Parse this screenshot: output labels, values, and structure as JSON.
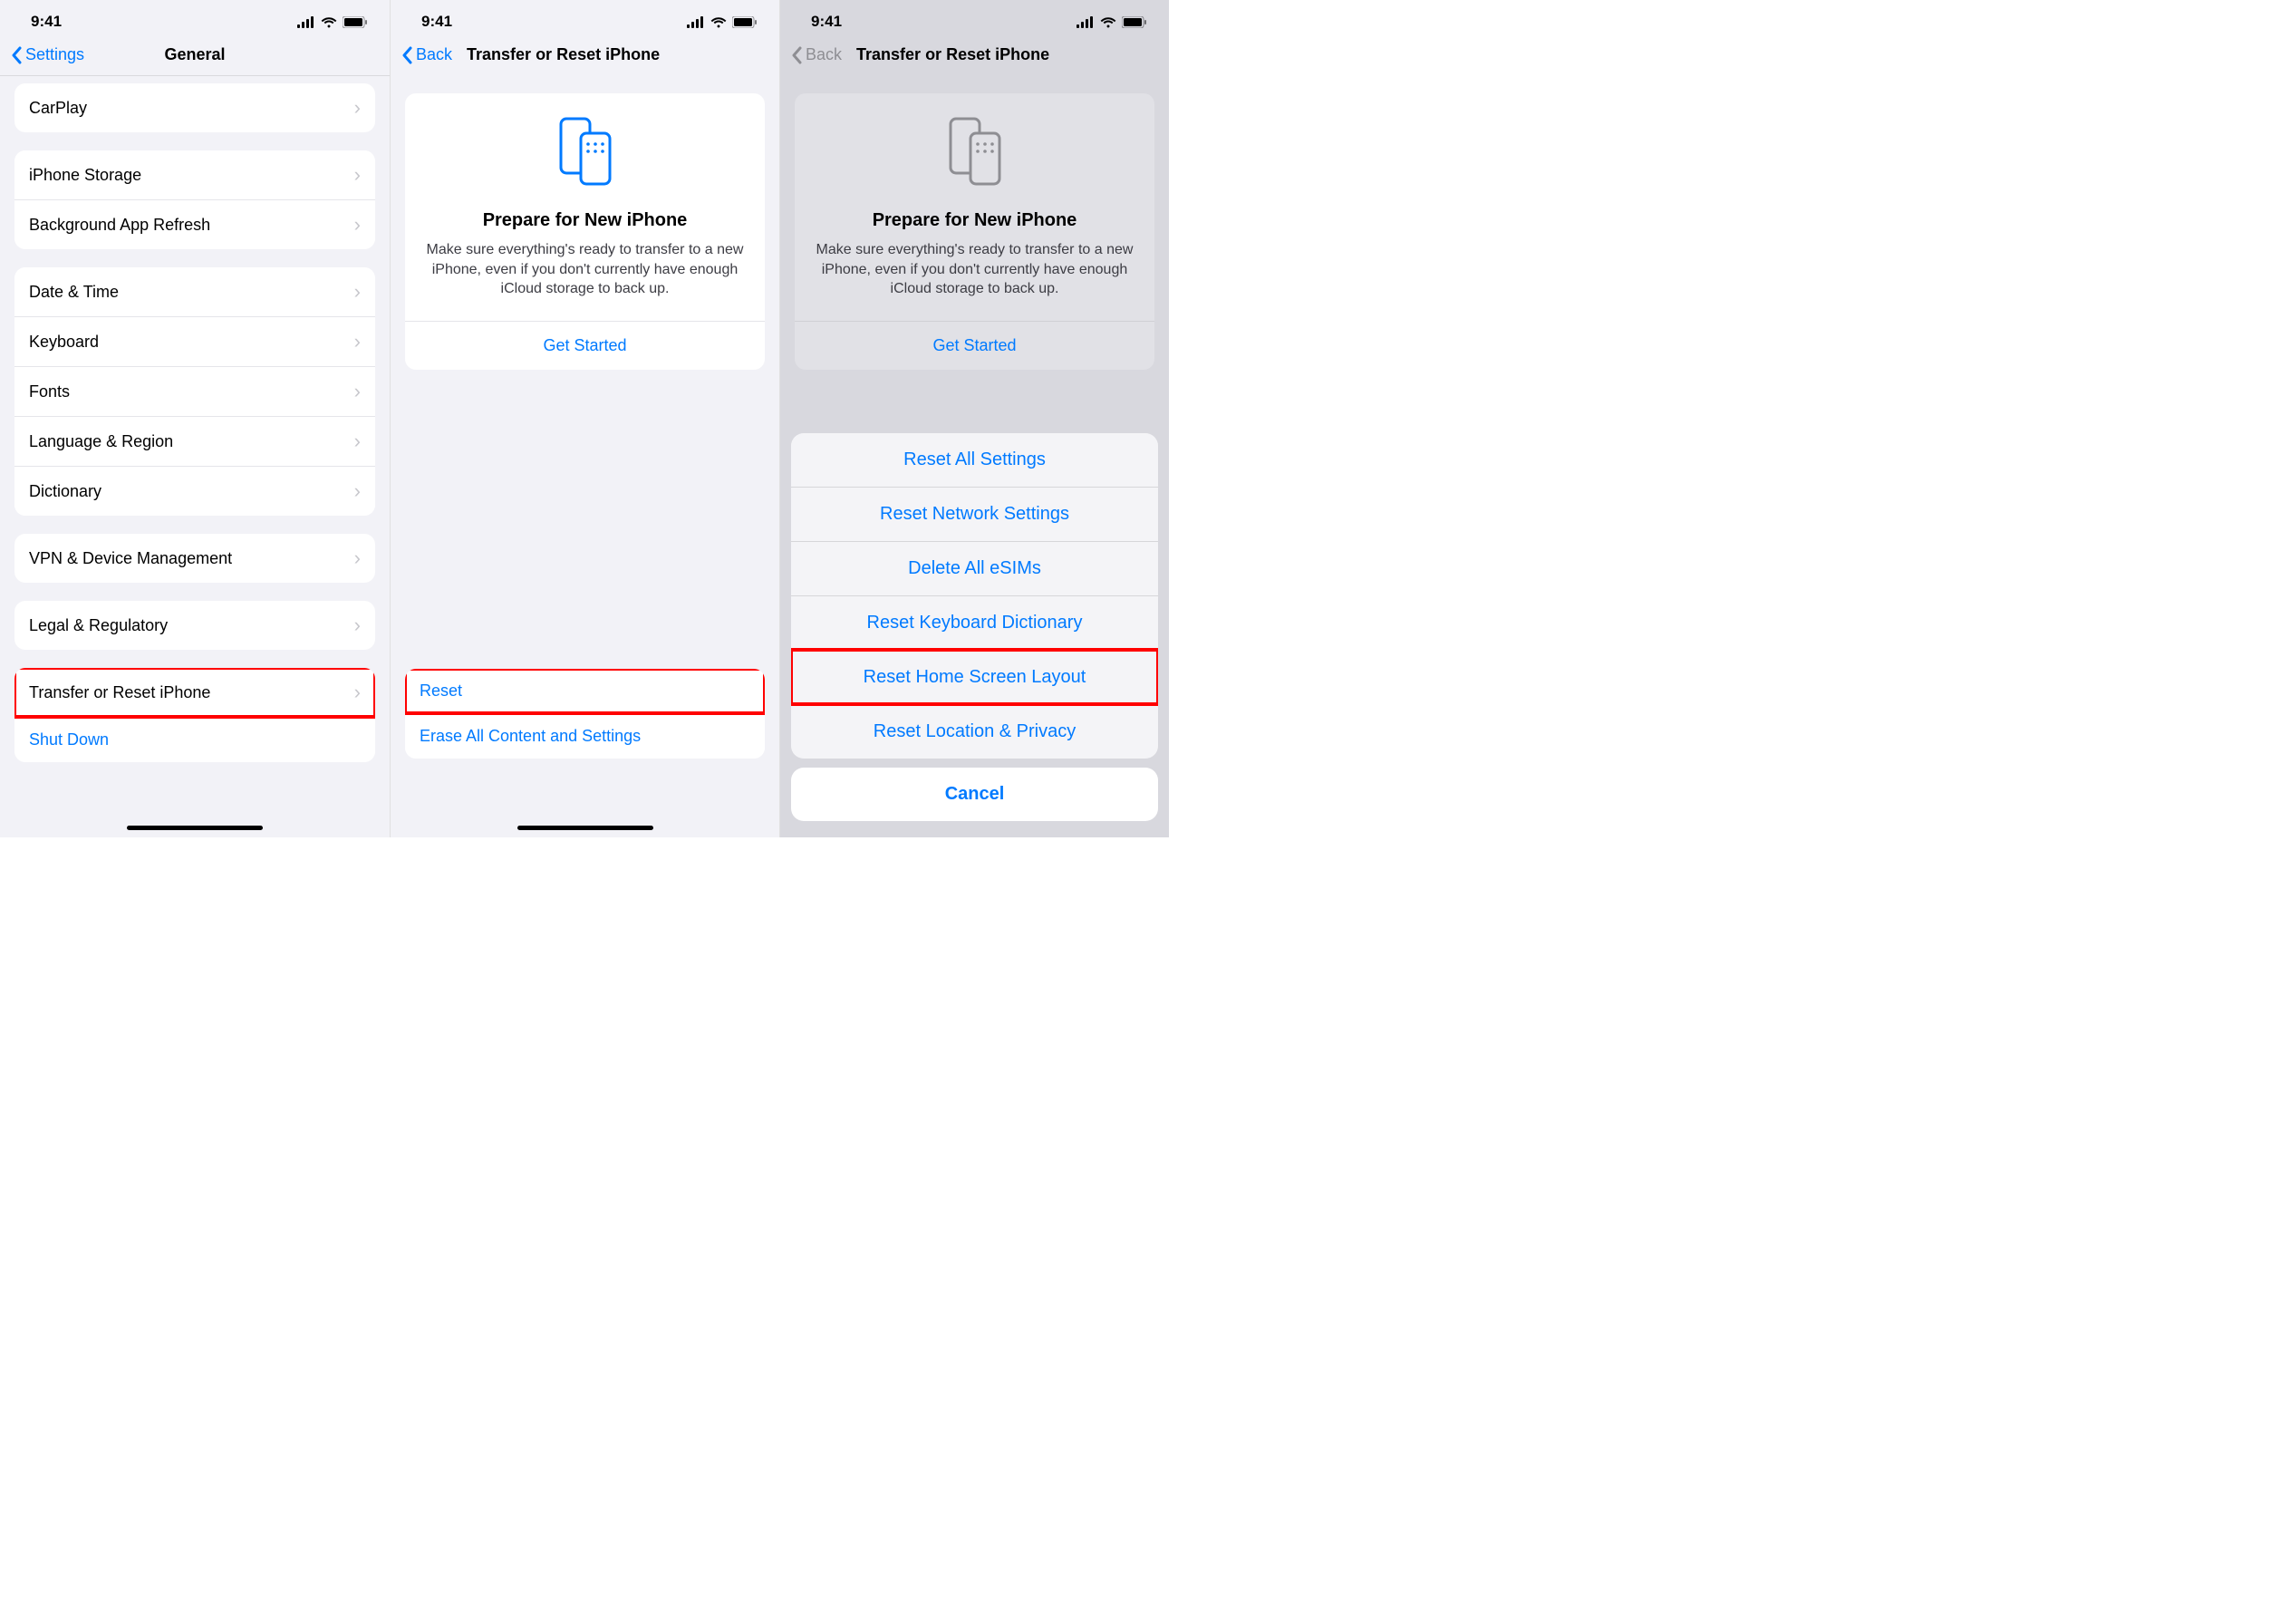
{
  "status": {
    "time": "9:41"
  },
  "screen1": {
    "back": "Settings",
    "title": "General",
    "groups": {
      "g0": [
        "CarPlay"
      ],
      "g1": [
        "iPhone Storage",
        "Background App Refresh"
      ],
      "g2": [
        "Date & Time",
        "Keyboard",
        "Fonts",
        "Language & Region",
        "Dictionary"
      ],
      "g3": [
        "VPN & Device Management"
      ],
      "g4": [
        "Legal & Regulatory"
      ],
      "g5": [
        "Transfer or Reset iPhone",
        "Shut Down"
      ]
    }
  },
  "screen2": {
    "back": "Back",
    "title": "Transfer or Reset iPhone",
    "card": {
      "title": "Prepare for New iPhone",
      "desc": "Make sure everything's ready to transfer to a new iPhone, even if you don't currently have enough iCloud storage to back up.",
      "action": "Get Started"
    },
    "list": [
      "Reset",
      "Erase All Content and Settings"
    ]
  },
  "screen3": {
    "back": "Back",
    "title": "Transfer or Reset iPhone",
    "card": {
      "title": "Prepare for New iPhone",
      "desc": "Make sure everything's ready to transfer to a new iPhone, even if you don't currently have enough iCloud storage to back up.",
      "action": "Get Started"
    },
    "sheet": {
      "items": [
        "Reset All Settings",
        "Reset Network Settings",
        "Delete All eSIMs",
        "Reset Keyboard Dictionary",
        "Reset Home Screen Layout",
        "Reset Location & Privacy"
      ],
      "cancel": "Cancel"
    }
  },
  "colors": {
    "accent": "#007aff",
    "highlight": "#ff0000"
  }
}
